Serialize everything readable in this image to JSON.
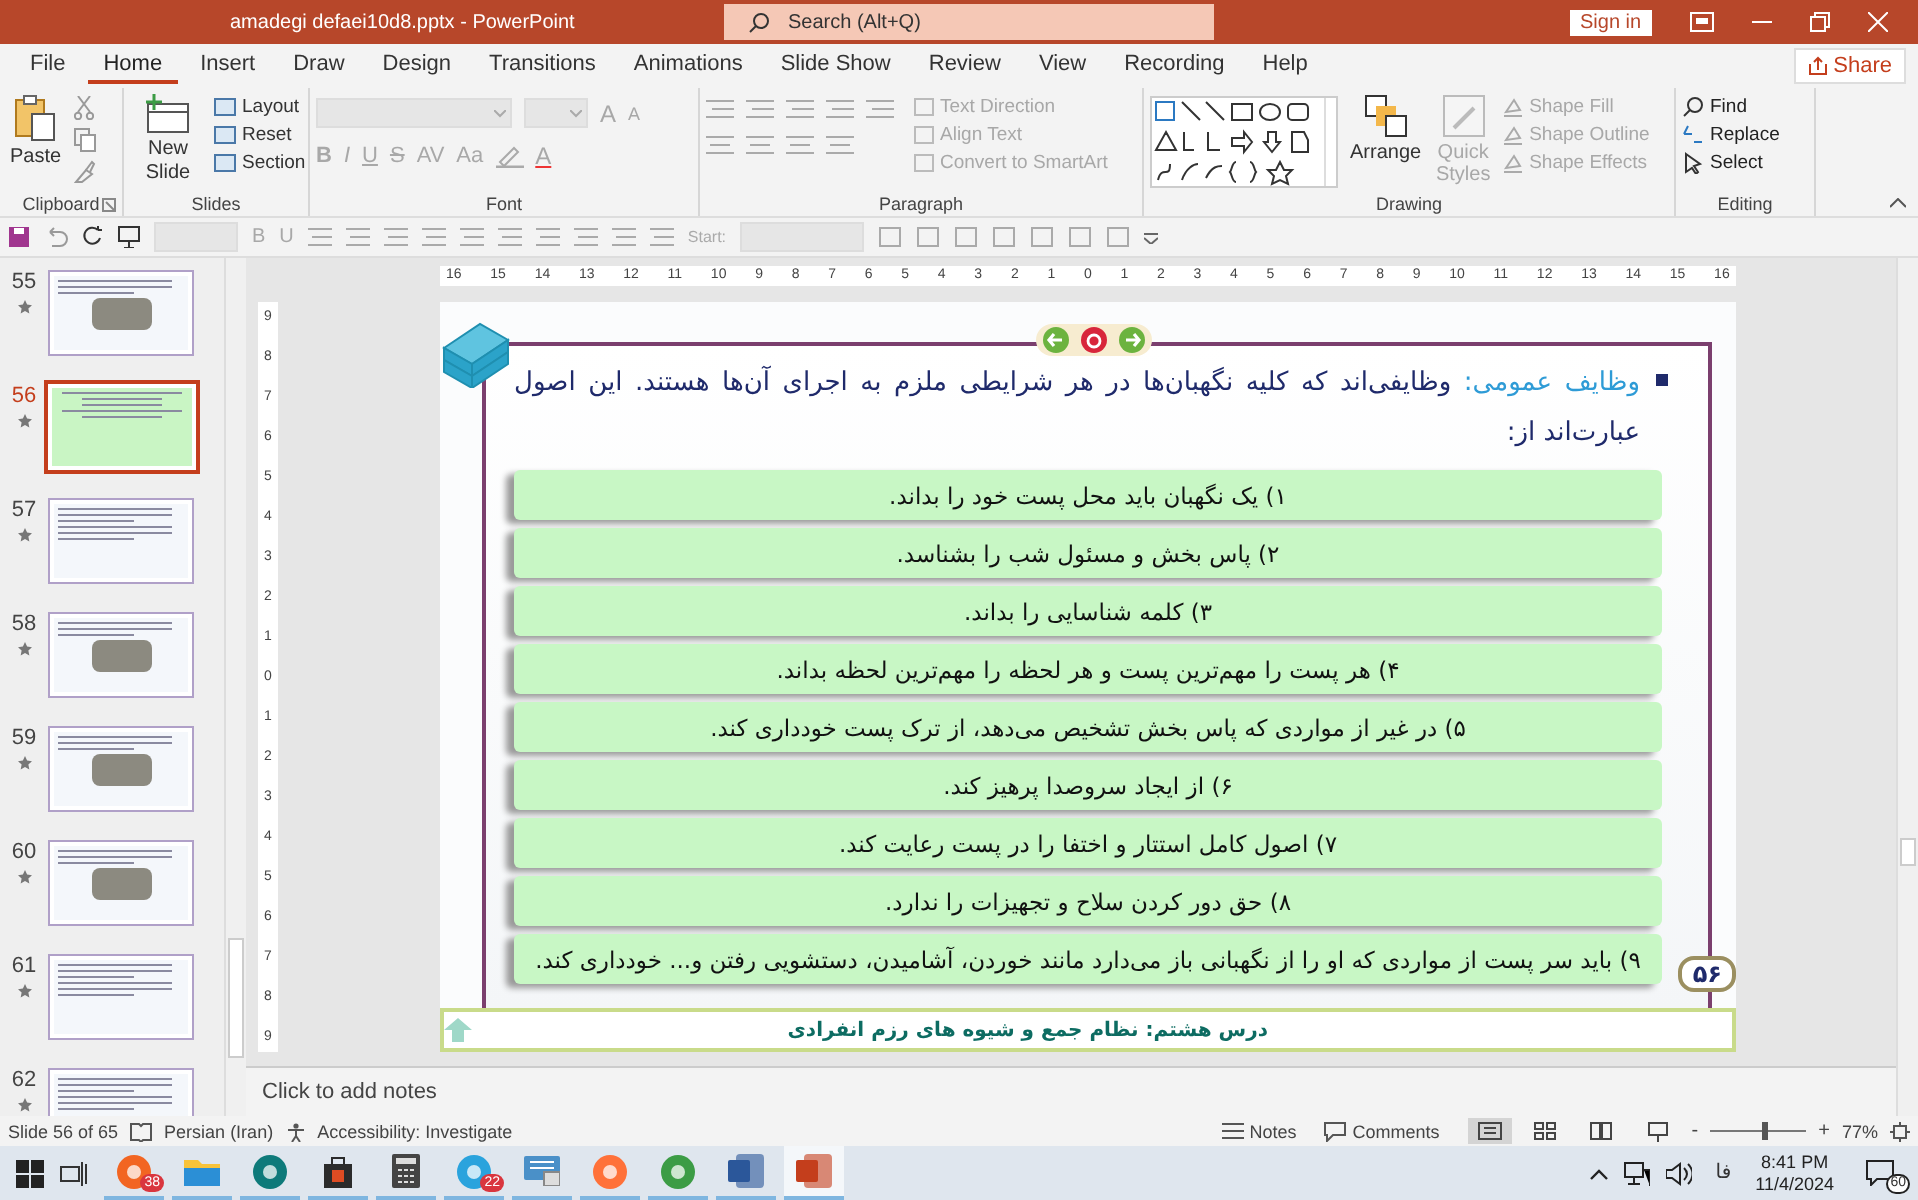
{
  "window": {
    "title": "amadegi defaei10d8.pptx  -  PowerPoint",
    "search_placeholder": "Search (Alt+Q)",
    "sign_in": "Sign in"
  },
  "menu_tabs": [
    {
      "label": "File",
      "selected": false
    },
    {
      "label": "Home",
      "selected": true
    },
    {
      "label": "Insert",
      "selected": false
    },
    {
      "label": "Draw",
      "selected": false
    },
    {
      "label": "Design",
      "selected": false
    },
    {
      "label": "Transitions",
      "selected": false
    },
    {
      "label": "Animations",
      "selected": false
    },
    {
      "label": "Slide Show",
      "selected": false
    },
    {
      "label": "Review",
      "selected": false
    },
    {
      "label": "View",
      "selected": false
    },
    {
      "label": "Recording",
      "selected": false
    },
    {
      "label": "Help",
      "selected": false
    }
  ],
  "share": "Share",
  "ribbon": {
    "clipboard": {
      "paste": "Paste",
      "label": "Clipboard"
    },
    "slides": {
      "new_slide": "New Slide",
      "items": [
        "Layout",
        "Reset",
        "Section"
      ],
      "label": "Slides"
    },
    "font": {
      "disabled": true,
      "size_buttons": [
        "A",
        "A"
      ],
      "format_buttons": [
        "B",
        "I",
        "U",
        "S",
        "AV",
        "Aa"
      ],
      "color_button": "A",
      "label": "Font"
    },
    "paragraph": {
      "disabled": true,
      "items": [
        "Text Direction",
        "Align Text",
        "Convert to SmartArt"
      ],
      "label": "Paragraph"
    },
    "drawing": {
      "arrange": {
        "label": "Arrange",
        "disabled": false
      },
      "quick_styles": {
        "label": "Quick Styles",
        "disabled": true
      },
      "items": [
        {
          "label": "Shape Fill",
          "disabled": true
        },
        {
          "label": "Shape Outline",
          "disabled": true
        },
        {
          "label": "Shape Effects",
          "disabled": true
        }
      ],
      "label": "Drawing"
    },
    "editing": {
      "items": [
        "Find",
        "Replace",
        "Select"
      ],
      "label": "Editing"
    }
  },
  "quick_access": {
    "buttons": [
      "B",
      "U"
    ],
    "start_label": "Start:"
  },
  "thumbnails": [
    {
      "number": "55",
      "kind": "photo",
      "selected": false
    },
    {
      "number": "56",
      "kind": "list",
      "selected": true
    },
    {
      "number": "57",
      "kind": "text",
      "selected": false
    },
    {
      "number": "58",
      "kind": "photo",
      "selected": false
    },
    {
      "number": "59",
      "kind": "photo",
      "selected": false
    },
    {
      "number": "60",
      "kind": "photo",
      "selected": false
    },
    {
      "number": "61",
      "kind": "text",
      "selected": false
    },
    {
      "number": "62",
      "kind": "text",
      "selected": false
    }
  ],
  "rulers": {
    "horizontal": [
      "16",
      "15",
      "14",
      "13",
      "12",
      "11",
      "10",
      "9",
      "8",
      "7",
      "6",
      "5",
      "4",
      "3",
      "2",
      "1",
      "0",
      "1",
      "2",
      "3",
      "4",
      "5",
      "6",
      "7",
      "8",
      "9",
      "10",
      "11",
      "12",
      "13",
      "14",
      "15",
      "16"
    ],
    "vertical": [
      "9",
      "8",
      "7",
      "6",
      "5",
      "4",
      "3",
      "2",
      "1",
      "0",
      "1",
      "2",
      "3",
      "4",
      "5",
      "6",
      "7",
      "8",
      "9"
    ]
  },
  "slide": {
    "intro": {
      "lead": "وظایف عمومی:",
      "text": "وظایفی‌اند که کلیه نگهبان‌ها در هر شرایطی ملزم به اجرای  آن‌ها هستند. این اصول عبارت‌اند از:"
    },
    "items": [
      "۱) یک نگهبان باید محل پست خود را بداند.",
      "۲) پاس بخش و مسئول شب را بشناسد.",
      "۳) کلمه شناسایی را بداند.",
      "۴) هر پست را مهم‌ترین پست و هر لحظه را مهم‌ترین لحظه بداند.",
      "۵) در غیر از مواردی که پاس بخش تشخیص می‌دهد، از ترک پست خودداری کند.",
      "۶) از ایجاد سروصدا پرهیز کند.",
      "۷) اصول کامل استتار و اختفا را در پست رعایت کند.",
      "۸) حق دور کردن سلاح و تجهیزات را ندارد.",
      "۹) باید سر پست از مواردی که او را از نگهبانی باز می‌دارد مانند خوردن، آشامیدن، دستشویی رفتن و... خودداری کند."
    ],
    "page_number": "۵۶",
    "footer": "درس هشتم: نظام جمع و شیوه های  رزم انفرادی"
  },
  "notes_placeholder": "Click to add notes",
  "status_bar": {
    "slide": "Slide 56 of 65",
    "language": "Persian (Iran)",
    "accessibility": "Accessibility: Investigate",
    "notes": "Notes",
    "comments": "Comments",
    "views": [
      {
        "kind": "normal",
        "selected": true
      },
      {
        "kind": "sorter",
        "selected": false
      },
      {
        "kind": "reading",
        "selected": false
      },
      {
        "kind": "slideshow",
        "selected": false
      }
    ],
    "zoom_out": "-",
    "zoom_in": "+",
    "zoom": {
      "level": 0.55,
      "reading": "77%"
    }
  },
  "taskbar": {
    "apps": [
      {
        "kind": "generic",
        "badge": "38",
        "selected": false
      },
      {
        "kind": "folder",
        "selected": false
      },
      {
        "kind": "globe",
        "selected": false
      },
      {
        "kind": "store",
        "selected": false
      },
      {
        "kind": "calculator",
        "selected": false
      },
      {
        "kind": "telegram",
        "badge": "22",
        "selected": false
      },
      {
        "kind": "remote",
        "selected": false
      },
      {
        "kind": "firefox",
        "selected": false
      },
      {
        "kind": "chrome",
        "selected": false
      },
      {
        "kind": "word",
        "selected": false
      },
      {
        "kind": "powerpoint",
        "selected": true
      }
    ],
    "language": "فا",
    "time": "8:41 PM",
    "date": "11/4/2024",
    "notifications": "60"
  }
}
